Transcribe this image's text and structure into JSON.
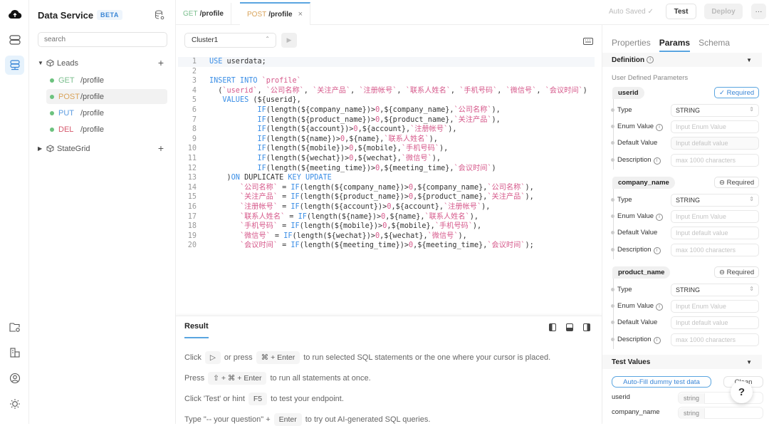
{
  "app": {
    "title": "Data Service",
    "badge": "BETA"
  },
  "rail": {
    "icons": [
      "cloud-upload-icon",
      "database-icon",
      "data-service-icon",
      "folder-settings-icon",
      "organization-icon",
      "user-icon",
      "theme-icon"
    ]
  },
  "sidebar": {
    "search_placeholder": "search",
    "groups": [
      {
        "name": "Leads",
        "expanded": true,
        "endpoints": [
          {
            "method": "GET",
            "path": "/profile",
            "color": "#7bbf8e"
          },
          {
            "method": "POST",
            "path": "/profile",
            "color": "#d9a35a",
            "selected": true
          },
          {
            "method": "PUT",
            "path": "/profile",
            "color": "#5a9be0"
          },
          {
            "method": "DEL",
            "path": "/profile",
            "color": "#d65a6e"
          }
        ]
      },
      {
        "name": "StateGrid",
        "expanded": false
      }
    ]
  },
  "tabs": [
    {
      "method": "GET",
      "path": "/profile",
      "active": false
    },
    {
      "method": "POST",
      "path": "/profile",
      "active": true,
      "close": "×"
    }
  ],
  "toolbar": {
    "auto_saved": "Auto Saved ✓",
    "test": "Test",
    "deploy": "Deploy",
    "more": "···"
  },
  "editor": {
    "cluster": "Cluster1",
    "lines": [
      "<span class=\"kw\">USE</span> userdata;",
      "",
      "<span class=\"kw\">INSERT INTO</span> <span class=\"st\">`profile`</span>",
      "  (<span class=\"st\">`userid`</span>, <span class=\"st\">`公司名称`</span>, <span class=\"st\">`关注产品`</span>, <span class=\"st\">`注册帐号`</span>, <span class=\"st\">`联系人姓名`</span>, <span class=\"st\">`手机号码`</span>, <span class=\"st\">`微信号`</span>, <span class=\"st\">`会议时间`</span>)",
      "   <span class=\"kw\">VALUES</span> (${userid},",
      "           <span class=\"kw\">IF</span>(length(${company_name})><span class=\"num\">0</span>,${company_name},<span class=\"st\">`公司名称`</span>),",
      "           <span class=\"kw\">IF</span>(length(${product_name})><span class=\"num\">0</span>,${product_name},<span class=\"st\">`关注产品`</span>),",
      "           <span class=\"kw\">IF</span>(length(${account})><span class=\"num\">0</span>,${account},<span class=\"st\">`注册帐号`</span>),",
      "           <span class=\"kw\">IF</span>(length(${name})><span class=\"num\">0</span>,${name},<span class=\"st\">`联系人姓名`</span>),",
      "           <span class=\"kw\">IF</span>(length(${mobile})><span class=\"num\">0</span>,${mobile},<span class=\"st\">`手机号码`</span>),",
      "           <span class=\"kw\">IF</span>(length(${wechat})><span class=\"num\">0</span>,${wechat},<span class=\"st\">`微信号`</span>),",
      "           <span class=\"kw\">IF</span>(length(${meeting_time})><span class=\"num\">0</span>,${meeting_time},<span class=\"st\">`会议时间`</span>)",
      "    )<span class=\"kw\">ON</span> DUPLICATE <span class=\"kw\">KEY UPDATE</span>",
      "       <span class=\"st\">`公司名称`</span> = <span class=\"kw\">IF</span>(length(${company_name})><span class=\"num\">0</span>,${company_name},<span class=\"st\">`公司名称`</span>),",
      "       <span class=\"st\">`关注产品`</span> = <span class=\"kw\">IF</span>(length(${product_name})><span class=\"num\">0</span>,${product_name},<span class=\"st\">`关注产品`</span>),",
      "       <span class=\"st\">`注册帐号`</span> = <span class=\"kw\">IF</span>(length(${account})><span class=\"num\">0</span>,${account},<span class=\"st\">`注册帐号`</span>),",
      "       <span class=\"st\">`联系人姓名`</span> = <span class=\"kw\">IF</span>(length(${name})><span class=\"num\">0</span>,${name},<span class=\"st\">`联系人姓名`</span>),",
      "       <span class=\"st\">`手机号码`</span> = <span class=\"kw\">IF</span>(length(${mobile})><span class=\"num\">0</span>,${mobile},<span class=\"st\">`手机号码`</span>),",
      "       <span class=\"st\">`微信号`</span> = <span class=\"kw\">IF</span>(length(${wechat})><span class=\"num\">0</span>,${wechat},<span class=\"st\">`微信号`</span>),",
      "       <span class=\"st\">`会议时间`</span> = <span class=\"kw\">IF</span>(length(${meeting_time})><span class=\"num\">0</span>,${meeting_time},<span class=\"st\">`会议时间`</span>);"
    ]
  },
  "result": {
    "tab": "Result",
    "hints": [
      {
        "parts": [
          "Click",
          {
            "key": "▷"
          },
          "or press",
          {
            "key": "⌘ + Enter"
          },
          "to run selected SQL statements or the one where your cursor is placed."
        ]
      },
      {
        "parts": [
          "Press",
          {
            "key": "⇧ + ⌘ + Enter"
          },
          "to run all statements at once."
        ]
      },
      {
        "parts": [
          "Click 'Test' or hint",
          {
            "key": "F5"
          },
          "to test your endpoint."
        ]
      },
      {
        "parts": [
          "Type \"-- your question\" +",
          {
            "key": "Enter"
          },
          "to try out AI-generated SQL queries."
        ]
      }
    ]
  },
  "right_panel": {
    "tabs": [
      {
        "label": "Properties"
      },
      {
        "label": "Params",
        "active": true
      },
      {
        "label": "Schema"
      }
    ],
    "definition": {
      "title": "Definition",
      "subtitle": "User Defined Parameters"
    },
    "field_labels": {
      "type": "Type",
      "enum": "Enum Value",
      "default": "Default Value",
      "description": "Description"
    },
    "placeholders": {
      "enum": "Input Enum Value",
      "default": "Input default value",
      "description": "max 1000 characters"
    },
    "params": [
      {
        "name": "userid",
        "required": true,
        "required_label": "Required",
        "type": "STRING"
      },
      {
        "name": "company_name",
        "required": false,
        "required_label": "Required",
        "type": "STRING"
      },
      {
        "name": "product_name",
        "required": false,
        "required_label": "Required",
        "type": "STRING"
      }
    ],
    "test_values": {
      "title": "Test Values",
      "autofill": "Auto-Fill dummy test data",
      "clean": "Clean",
      "rows": [
        {
          "name": "userid",
          "type": "string"
        },
        {
          "name": "company_name",
          "type": "string"
        }
      ]
    },
    "help": "?"
  }
}
